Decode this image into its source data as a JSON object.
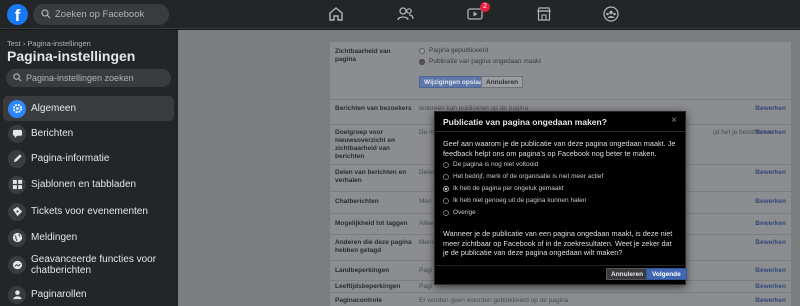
{
  "topbar": {
    "logo": "f",
    "search_placeholder": "Zoeken op Facebook",
    "nav": [
      {
        "icon": "home-icon"
      },
      {
        "icon": "friends-icon"
      },
      {
        "icon": "watch-icon",
        "badge": "2"
      },
      {
        "icon": "marketplace-icon"
      },
      {
        "icon": "groups-icon"
      }
    ]
  },
  "sidebar": {
    "breadcrumb": "Test › Pagina-instellingen",
    "title": "Pagina-instellingen",
    "search_placeholder": "Pagina-instellingen zoeken",
    "items": [
      {
        "label": "Algemeen",
        "icon": "gear-icon",
        "active": true
      },
      {
        "label": "Berichten",
        "icon": "chat-icon"
      },
      {
        "label": "Pagina-informatie",
        "icon": "pencil-icon"
      },
      {
        "label": "Sjablonen en tabbladen",
        "icon": "grid-icon"
      },
      {
        "label": "Tickets voor evenementen",
        "icon": "ticket-icon"
      },
      {
        "label": "Meldingen",
        "icon": "globe-icon"
      },
      {
        "label": "Geavanceerde functies voor chatberichten",
        "icon": "messenger-icon"
      },
      {
        "label": "Paginarollen",
        "icon": "person-icon"
      }
    ]
  },
  "settings": {
    "visibility_label": "Zichtbaarheid van pagina",
    "visibility_options": [
      "Pagina gepubliceerd",
      "Publicatie van pagina ongedaan maakt"
    ],
    "save_label": "Wijzigingen opslaan",
    "cancel_label": "Annuleren",
    "edit_label": "Bewerken",
    "rows": [
      {
        "label": "Berichten van bezoekers",
        "value": "Iedereen kan publiceren op de pagina"
      },
      {
        "label": "Doelgroep voor nieuwsoverzicht en zichtbaarheid van berichten",
        "value": "De m"
      },
      {
        "label": "Delen van berichten en verhalen",
        "value": "Delen"
      },
      {
        "label": "Chatberichten",
        "value": "Men"
      },
      {
        "label": "Mogelijkheid tot taggen",
        "value": "Allee"
      },
      {
        "label": "Anderen die deze pagina hebben getagd",
        "value": "Mens"
      },
      {
        "label": "Landbeperkingen",
        "value": "Pagi"
      },
      {
        "label": "Leeftijdsbeperkingen",
        "value": "Pagi"
      },
      {
        "label": "Paginacontrole",
        "value": "Er worden geen woorden geblokkeerd op de pagina"
      }
    ],
    "row2_extra": "ijd het je berichten te"
  },
  "modal": {
    "title": "Publicatie van pagina ongedaan maken?",
    "close": "×",
    "intro": "Geef aan waarom je de publicatie van deze pagina ongedaan maakt. Je feedback helpt ons om pagina's op Facebook nog beter te maken.",
    "options": [
      {
        "label": "De pagina is nog niet voltooid",
        "selected": false
      },
      {
        "label": "Het bedrijf, merk of de organisatie is niet meer actief",
        "selected": false
      },
      {
        "label": "Ik heb de pagina per ongeluk gemaakt",
        "selected": true
      },
      {
        "label": "Ik heb niet genoeg uit de pagina kunnen halen",
        "selected": false
      },
      {
        "label": "Overige",
        "selected": false
      }
    ],
    "warning": "Wanneer je de publicatie van een pagina ongedaan maakt, is deze niet meer zichtbaar op Facebook of in de zoekresultaten. Weet je zeker dat je de publicatie van deze pagina ongedaan wilt maken?",
    "cancel_label": "Annuleren",
    "next_label": "Volgende"
  },
  "colors": {
    "accent": "#2d88ff",
    "brand": "#1877f2",
    "primary_button": "#4267b2"
  }
}
